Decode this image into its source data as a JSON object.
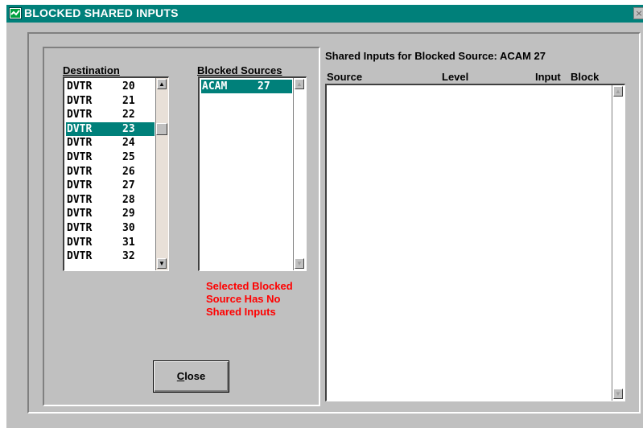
{
  "window": {
    "title": "BLOCKED SHARED INPUTS",
    "close_glyph": "×"
  },
  "destination": {
    "label": "Destination",
    "items": [
      {
        "name": "DVTR",
        "num": "20"
      },
      {
        "name": "DVTR",
        "num": "21"
      },
      {
        "name": "DVTR",
        "num": "22"
      },
      {
        "name": "DVTR",
        "num": "23"
      },
      {
        "name": "DVTR",
        "num": "24"
      },
      {
        "name": "DVTR",
        "num": "25"
      },
      {
        "name": "DVTR",
        "num": "26"
      },
      {
        "name": "DVTR",
        "num": "27"
      },
      {
        "name": "DVTR",
        "num": "28"
      },
      {
        "name": "DVTR",
        "num": "29"
      },
      {
        "name": "DVTR",
        "num": "30"
      },
      {
        "name": "DVTR",
        "num": "31"
      },
      {
        "name": "DVTR",
        "num": "32"
      }
    ],
    "selected_index": 3,
    "scroll_up_glyph": "▲",
    "scroll_down_glyph": "▼"
  },
  "blocked_sources": {
    "label": "Blocked Sources",
    "items": [
      {
        "name": "ACAM",
        "num": "27"
      }
    ],
    "selected_index": 0,
    "scroll_up_glyph": "▲",
    "scroll_down_glyph": "▼"
  },
  "warning": {
    "text": "Selected Blocked Source Has No Shared Inputs",
    "color": "#ff0000"
  },
  "shared_inputs": {
    "title": "Shared Inputs for Blocked Source: ACAM  27",
    "columns": [
      "Source",
      "Level",
      "Input",
      "Block"
    ],
    "rows": [],
    "scroll_up_glyph": "▲",
    "scroll_down_glyph": "▼"
  },
  "close_button": {
    "mnemonic": "C",
    "rest": "lose"
  },
  "colors": {
    "titlebar": "#00807a",
    "selection": "#00807a",
    "window_bg": "#c0c0c0"
  }
}
